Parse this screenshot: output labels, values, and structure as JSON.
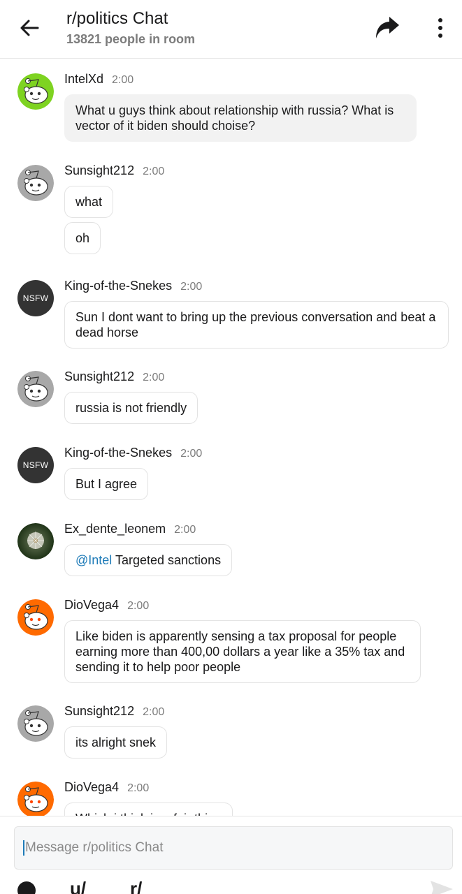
{
  "header": {
    "title": "r/politics Chat",
    "subtitle": "13821 people in room"
  },
  "messages": [
    {
      "user": "IntelXd",
      "time": "2:00",
      "avatar": "snoo-green",
      "texts": [
        "What u guys think about relationship with russia? What is vector of it  biden should choise?"
      ]
    },
    {
      "user": "Sunsight212",
      "time": "2:00",
      "avatar": "snoo-gray",
      "texts": [
        "what",
        "oh"
      ]
    },
    {
      "user": "King-of-the-Snekes",
      "time": "2:00",
      "avatar": "nsfw",
      "avatar_label": "NSFW",
      "texts": [
        "Sun I dont want to bring up the previous conversation and beat a dead horse"
      ]
    },
    {
      "user": "Sunsight212",
      "time": "2:00",
      "avatar": "snoo-gray",
      "texts": [
        "russia is not friendly"
      ]
    },
    {
      "user": "King-of-the-Snekes",
      "time": "2:00",
      "avatar": "nsfw",
      "avatar_label": "NSFW",
      "texts": [
        "But I agree"
      ]
    },
    {
      "user": "Ex_dente_leonem",
      "time": "2:00",
      "avatar": "dandelion-photo",
      "mention": "@Intel",
      "texts": [
        "Targeted sanctions"
      ]
    },
    {
      "user": "DioVega4",
      "time": "2:00",
      "avatar": "snoo-orange",
      "texts": [
        "Like biden is apparently sensing a tax proposal for people earning more than 400,00 dollars a year like a 35% tax and sending it to help poor people"
      ]
    },
    {
      "user": "Sunsight212",
      "time": "2:00",
      "avatar": "snoo-gray",
      "texts": [
        "its alright snek"
      ]
    },
    {
      "user": "DioVega4",
      "time": "2:00",
      "avatar": "snoo-orange",
      "texts": [
        "Which i think is a fair thing"
      ]
    }
  ],
  "composer": {
    "placeholder": "Message r/politics Chat",
    "tools": [
      "u/",
      "r/"
    ]
  },
  "colors": {
    "accent": "#1e7bb8",
    "snoo_green": "#7ed321",
    "snoo_orange": "#ff6a00",
    "snoo_gray": "#a8a8a8"
  },
  "icons": [
    "back-arrow-icon",
    "share-icon",
    "more-vertical-icon",
    "send-icon",
    "emoji-icon"
  ]
}
